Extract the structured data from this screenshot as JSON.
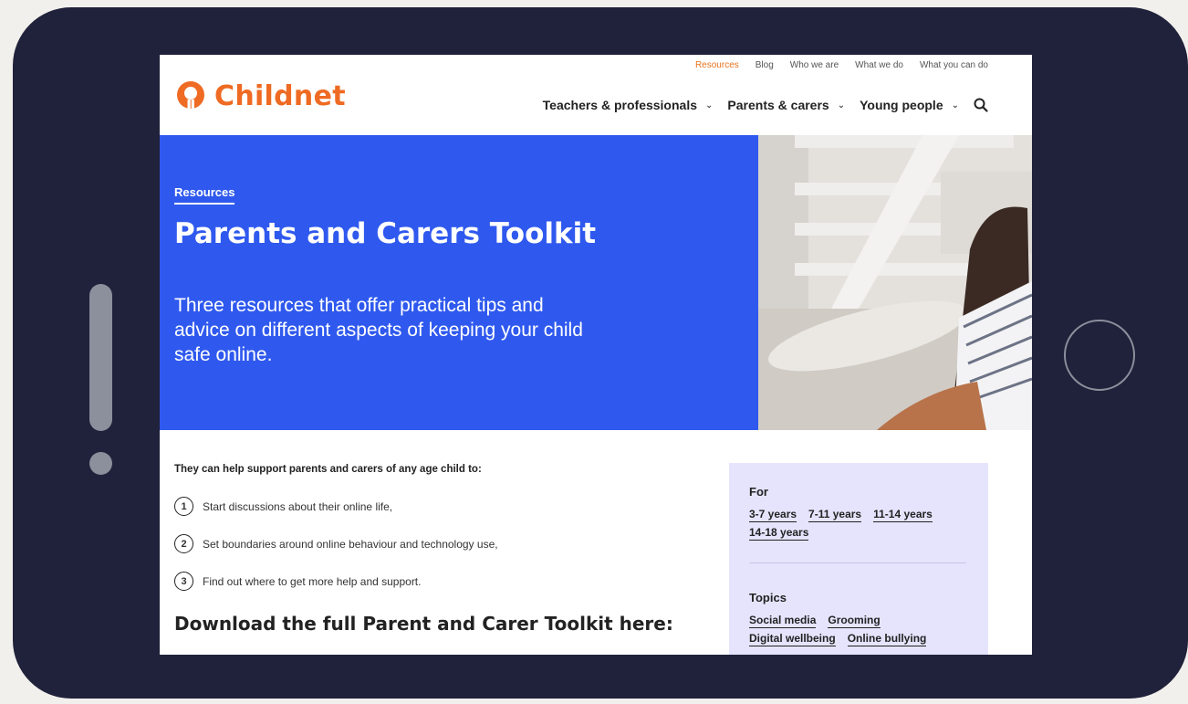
{
  "brand": {
    "name": "Childnet",
    "color": "#ef6a23"
  },
  "utility_nav": [
    {
      "label": "Resources",
      "active": true
    },
    {
      "label": "Blog",
      "active": false
    },
    {
      "label": "Who we are",
      "active": false
    },
    {
      "label": "What we do",
      "active": false
    },
    {
      "label": "What you can do",
      "active": false
    }
  ],
  "main_nav": [
    {
      "label": "Teachers & professionals",
      "icon": "chevron-down-icon"
    },
    {
      "label": "Parents & carers",
      "icon": "chevron-down-icon"
    },
    {
      "label": "Young people",
      "icon": "chevron-down-icon"
    }
  ],
  "search": {
    "icon": "search-icon"
  },
  "hero": {
    "breadcrumb": "Resources",
    "title": "Parents and Carers Toolkit",
    "subtitle": "Three resources that offer practical tips and advice on different aspects of keeping your child safe online.",
    "background": "#2f59ee"
  },
  "content": {
    "intro": "They can help support parents and carers of any age child to:",
    "steps": [
      {
        "number": "1",
        "text": "Start discussions about their online life,"
      },
      {
        "number": "2",
        "text": "Set boundaries around online behaviour and technology use,"
      },
      {
        "number": "3",
        "text": "Find out where to get more help and support."
      }
    ],
    "download_heading": "Download the full Parent and Carer Toolkit here:"
  },
  "sidebar": {
    "for_label": "For",
    "age_tags": [
      "3-7 years",
      "7-11 years",
      "11-14 years",
      "14-18 years"
    ],
    "topics_label": "Topics",
    "topic_tags": [
      "Social media",
      "Grooming",
      "Digital wellbeing",
      "Online bullying"
    ],
    "background": "#e6e4fd"
  }
}
